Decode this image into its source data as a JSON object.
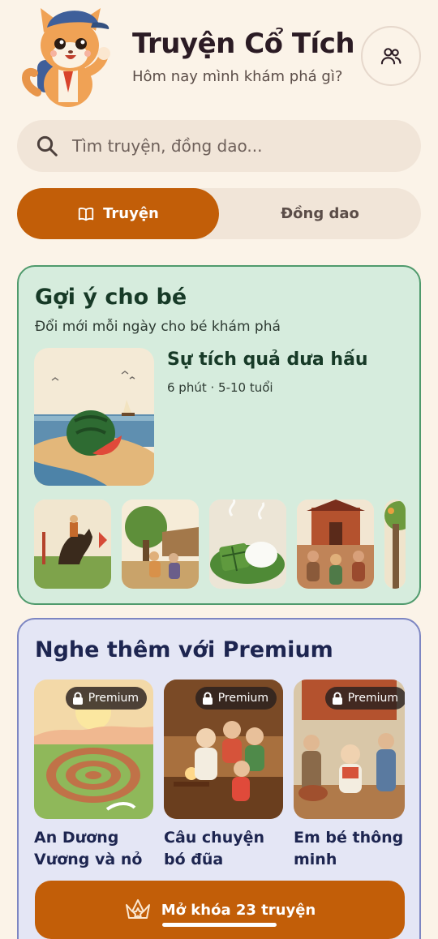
{
  "header": {
    "title": "Truyện Cổ Tích",
    "subtitle": "Hôm nay mình khám phá gì?",
    "mascot_icon": "cat-mascot-icon",
    "profile_icon": "users-icon"
  },
  "search": {
    "placeholder": "Tìm truyện, đồng dao..."
  },
  "tabs": [
    {
      "label": "Truyện",
      "active": true,
      "icon": "book-open-icon"
    },
    {
      "label": "Đồng dao",
      "active": false
    }
  ],
  "suggest": {
    "title": "Gợi ý cho bé",
    "subtitle": "Đổi mới mỗi ngày cho bé khám phá",
    "featured": {
      "title": "Sự tích quả dưa hấu",
      "meta": "6 phút · 5-10 tuổi"
    },
    "thumbnails": [
      "hero-on-horse-thumbnail",
      "village-family-thumbnail",
      "sticky-rice-cakes-thumbnail",
      "royal-court-thumbnail",
      "tree-thumbnail"
    ]
  },
  "premium": {
    "title": "Nghe thêm với Premium",
    "badge_label": "Premium",
    "cards": [
      {
        "title": "An Dương Vương và nỏ t..."
      },
      {
        "title": "Câu chuyện bó đũa"
      },
      {
        "title": "Em bé thông minh"
      }
    ],
    "unlock_label": "Mở khóa 23 truyện"
  },
  "colors": {
    "background": "#fbf3e8",
    "accent": "#c25e08",
    "suggest_bg": "#d6ecdd",
    "premium_bg": "#e4e6f5"
  }
}
